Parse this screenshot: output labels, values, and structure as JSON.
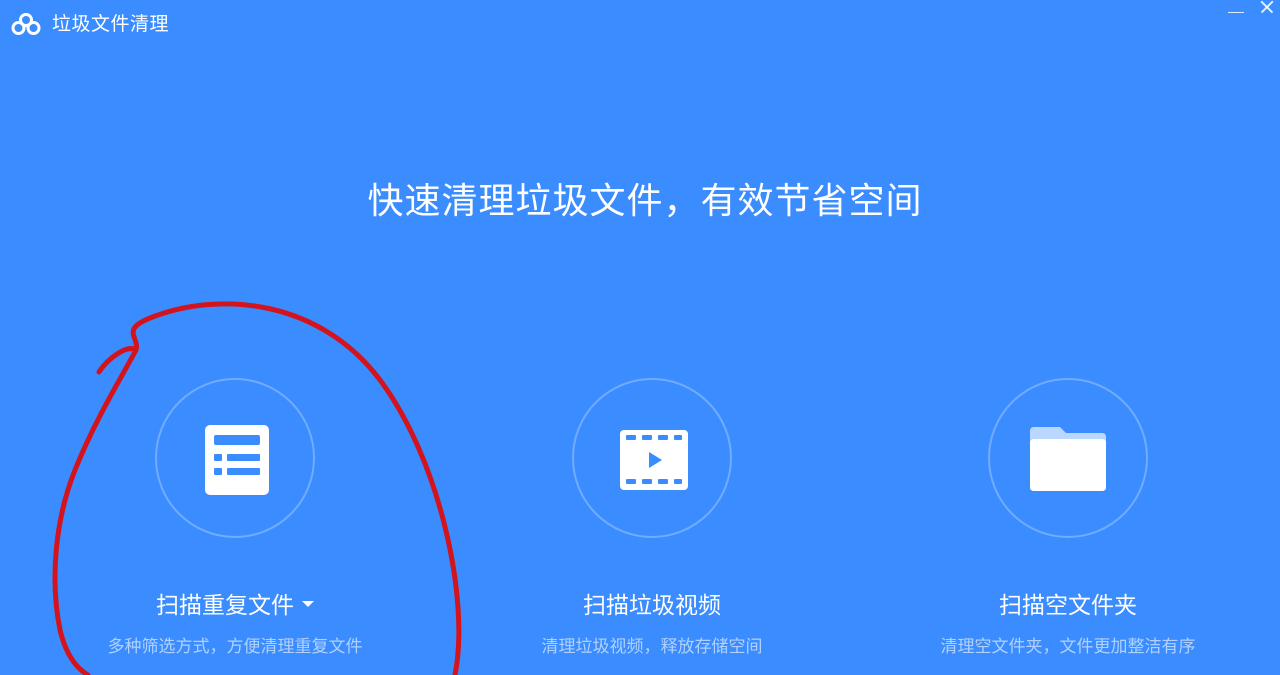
{
  "window": {
    "title": "垃圾文件清理",
    "logo_icon": "cloud-logo-icon",
    "minimize_icon": "minimize-icon",
    "close_icon": "close-icon"
  },
  "headline": "快速清理垃圾文件，有效节省空间",
  "options": [
    {
      "label": "扫描重复文件",
      "description": "多种筛选方式，方便清理重复文件",
      "icon": "file-list-icon",
      "has_dropdown": true
    },
    {
      "label": "扫描垃圾视频",
      "description": "清理垃圾视频，释放存储空间",
      "icon": "video-film-icon",
      "has_dropdown": false
    },
    {
      "label": "扫描空文件夹",
      "description": "清理空文件夹，文件更加整洁有序",
      "icon": "folder-icon",
      "has_dropdown": false
    }
  ],
  "colors": {
    "background": "#3a8cff",
    "text": "#ffffff",
    "annotation": "#d4141c"
  }
}
